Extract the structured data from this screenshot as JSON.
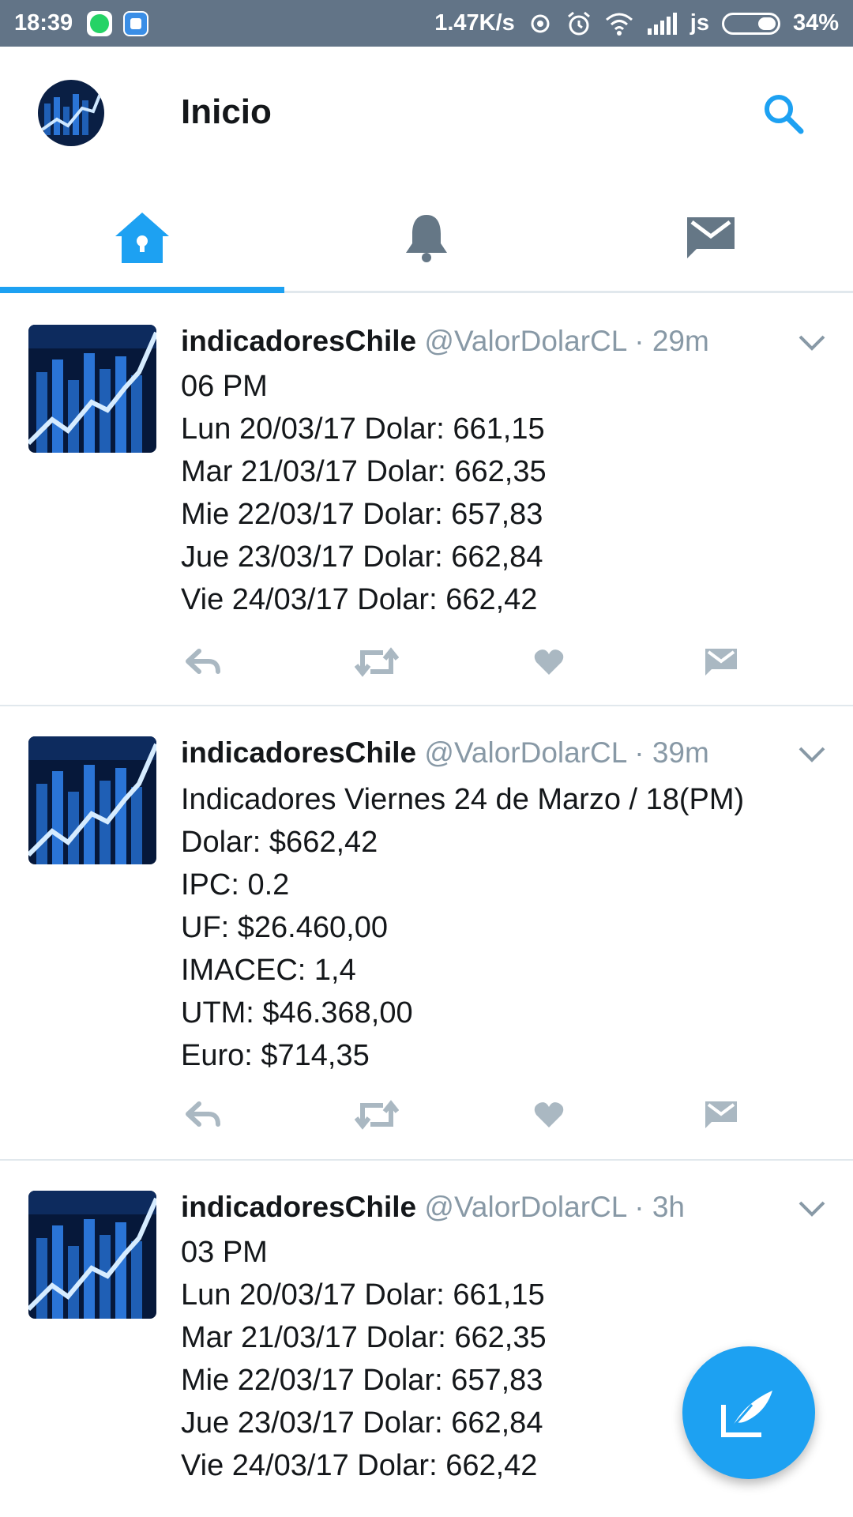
{
  "status_bar": {
    "time": "18:39",
    "network_speed": "1.47K/s",
    "carrier": "js",
    "battery": "34%",
    "notification_icons": [
      "whatsapp-icon",
      "app-notification-icon"
    ],
    "system_icons": [
      "sync-icon",
      "alarm-icon",
      "wifi-icon",
      "signal-icon",
      "battery-icon"
    ]
  },
  "header": {
    "title": "Inicio",
    "search_icon": "search-icon"
  },
  "tabs": [
    {
      "name": "home",
      "icon": "home-icon",
      "active": true
    },
    {
      "name": "notifications",
      "icon": "bell-icon",
      "active": false
    },
    {
      "name": "messages",
      "icon": "envelope-icon",
      "active": false
    }
  ],
  "colors": {
    "accent": "#1da1f2",
    "status_bar": "#627487",
    "icon_gray": "#aab8c2",
    "tab_icon_gray": "#657786",
    "handle_gray": "#8899a6"
  },
  "tweets": [
    {
      "name": "indicadoresChile",
      "handle": "@ValorDolarCL",
      "time": "· 29m",
      "lines": [
        "06 PM",
        "Lun 20/03/17 Dolar: 661,15",
        "Mar 21/03/17 Dolar: 662,35",
        "Mie 22/03/17 Dolar: 657,83",
        "Jue 23/03/17 Dolar: 662,84",
        "Vie 24/03/17 Dolar: 662,42"
      ]
    },
    {
      "name": "indicadoresChile",
      "handle": "@ValorDolarCL",
      "time": "· 39m",
      "lines": [
        "Indicadores Viernes 24 de Marzo / 18(PM)",
        "Dolar: $662,42",
        "IPC: 0.2",
        "UF: $26.460,00",
        "IMACEC: 1,4",
        "UTM: $46.368,00",
        "Euro: $714,35"
      ]
    },
    {
      "name": "indicadoresChile",
      "handle": "@ValorDolarCL",
      "time": "· 3h",
      "lines": [
        "03 PM",
        "Lun 20/03/17 Dolar: 661,15",
        "Mar 21/03/17 Dolar: 662,35",
        "Mie 22/03/17 Dolar: 657,83",
        "Jue 23/03/17 Dolar: 662,84",
        "Vie 24/03/17 Dolar: 662,42"
      ]
    }
  ],
  "tweet_actions": [
    "reply-icon",
    "retweet-icon",
    "like-icon",
    "direct-message-icon"
  ],
  "fab": {
    "icon": "compose-tweet-icon"
  }
}
